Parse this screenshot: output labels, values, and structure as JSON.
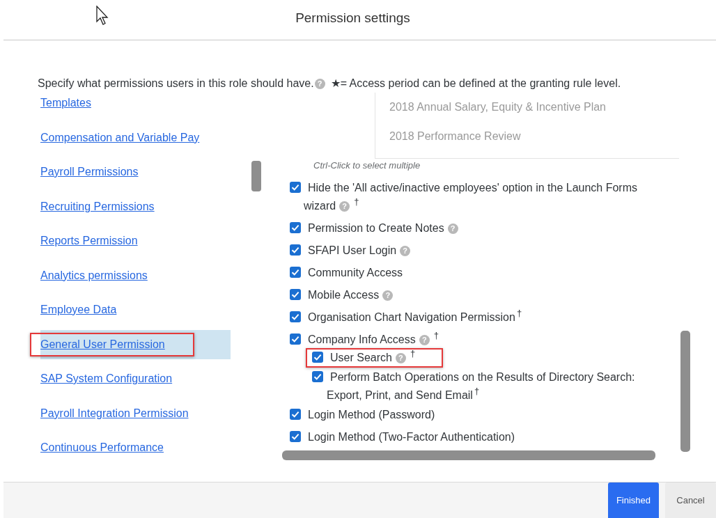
{
  "window": {
    "title": "Permission settings"
  },
  "intro": {
    "text": "Specify what permissions users in this role should have.",
    "help": "?",
    "legend": "★= Access period can be defined at the granting rule level."
  },
  "nav": {
    "items": [
      {
        "label": "Templates",
        "selected": false,
        "marked": false
      },
      {
        "label": "Compensation and Variable Pay",
        "selected": false,
        "marked": false
      },
      {
        "label": "Payroll Permissions",
        "selected": false,
        "marked": false
      },
      {
        "label": "Recruiting Permissions",
        "selected": false,
        "marked": false
      },
      {
        "label": "Reports Permission",
        "selected": false,
        "marked": false
      },
      {
        "label": "Analytics permissions",
        "selected": false,
        "marked": false
      },
      {
        "label": "Employee Data",
        "selected": false,
        "marked": false
      },
      {
        "label": "General User Permission",
        "selected": true,
        "marked": true
      },
      {
        "label": "SAP System Configuration",
        "selected": false,
        "marked": false
      },
      {
        "label": "Payroll Integration Permission",
        "selected": false,
        "marked": false
      },
      {
        "label": "Continuous Performance",
        "selected": false,
        "marked": false
      }
    ]
  },
  "plans": {
    "items": [
      "2018 Annual Salary, Equity & Incentive Plan",
      "2018 Performance Review"
    ],
    "hint": "Ctrl-Click to select multiple"
  },
  "permissions": [
    {
      "label": "Hide the 'All active/inactive employees' option in the Launch Forms wizard",
      "checked": true,
      "help": "?",
      "note": "†",
      "marked": false
    },
    {
      "label": "Permission to Create Notes",
      "checked": true,
      "help": "?",
      "marked": false
    },
    {
      "label": "SFAPI User Login",
      "checked": true,
      "help": "?",
      "marked": false
    },
    {
      "label": "Community Access",
      "checked": true,
      "marked": false
    },
    {
      "label": "Mobile Access",
      "checked": true,
      "help": "?",
      "marked": false
    },
    {
      "label": "Organisation Chart Navigation Permission",
      "checked": true,
      "note": "†",
      "marked": false
    },
    {
      "label": "Company Info Access",
      "checked": true,
      "help": "?",
      "note": "†",
      "marked": false,
      "children": [
        {
          "label": "User Search",
          "checked": true,
          "help": "?",
          "note": "†",
          "marked": true
        },
        {
          "label": "Perform Batch Operations on the Results of Directory Search: Export, Print, and Send Email",
          "checked": true,
          "note": "†",
          "marked": false
        }
      ]
    },
    {
      "label": "Login Method (Password)",
      "checked": true,
      "marked": false
    },
    {
      "label": "Login Method (Two-Factor Authentication)",
      "checked": true,
      "marked": false
    }
  ],
  "buttons": [
    {
      "label": "Finished",
      "kind": "primary"
    },
    {
      "label": "Cancel",
      "kind": "secondary"
    }
  ]
}
